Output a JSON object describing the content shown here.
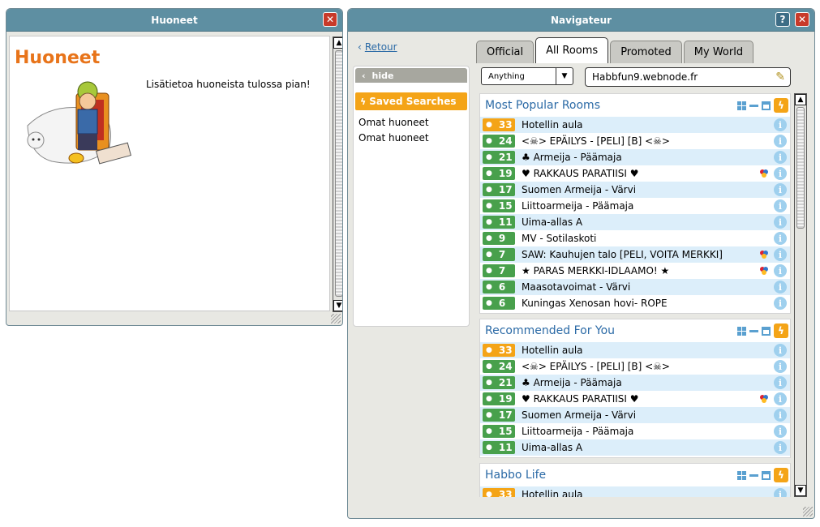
{
  "huoneet": {
    "title": "Huoneet",
    "heading": "Huoneet",
    "text": "Lisätietoa huoneista tulossa pian!"
  },
  "navigator": {
    "title": "Navigateur",
    "back": "Retour",
    "tabs": [
      "Official",
      "All Rooms",
      "Promoted",
      "My World"
    ],
    "active_tab": "All Rooms",
    "sidebar": {
      "hide": "hide",
      "saved_searches": "Saved Searches",
      "links": [
        "Omat huoneet",
        "Omat huoneet"
      ]
    },
    "filter": "Anything",
    "search_value": "Habbfun9.webnode.fr",
    "sections": [
      {
        "title": "Most Popular Rooms",
        "rooms": [
          {
            "count": "33",
            "name": "Hotellin aula",
            "color": "orange",
            "group": false
          },
          {
            "count": "24",
            "name": "<☠> EPÄILYS - [PELI] [B] <☠>",
            "color": "green",
            "group": false
          },
          {
            "count": "21",
            "name": "♣ Armeija - Päämaja",
            "color": "green",
            "group": false
          },
          {
            "count": "19",
            "name": "♥  RAKKAUS PARATIISI ♥",
            "color": "green",
            "group": true
          },
          {
            "count": "17",
            "name": "Suomen Armeija - Värvi",
            "color": "green",
            "group": false
          },
          {
            "count": "15",
            "name": "Liittoarmeija - Päämaja",
            "color": "green",
            "group": false
          },
          {
            "count": "11",
            "name": "Uima-allas A",
            "color": "green",
            "group": false
          },
          {
            "count": "9",
            "name": "MV - Sotilaskoti",
            "color": "green",
            "group": false
          },
          {
            "count": "7",
            "name": "SAW: Kauhujen talo [PELI, VOITA MERKKI]",
            "color": "green",
            "group": true
          },
          {
            "count": "7",
            "name": "★ PARAS MERKKI-IDLAAMO! ★",
            "color": "green",
            "group": true
          },
          {
            "count": "6",
            "name": "Maasotavoimat - Värvi",
            "color": "green",
            "group": false
          },
          {
            "count": "6",
            "name": "Kuningas Xenosan hovi- ROPE",
            "color": "green",
            "group": false
          }
        ]
      },
      {
        "title": "Recommended For You",
        "rooms": [
          {
            "count": "33",
            "name": "Hotellin aula",
            "color": "orange",
            "group": false
          },
          {
            "count": "24",
            "name": "<☠> EPÄILYS - [PELI] [B] <☠>",
            "color": "green",
            "group": false
          },
          {
            "count": "21",
            "name": "♣ Armeija - Päämaja",
            "color": "green",
            "group": false
          },
          {
            "count": "19",
            "name": "♥  RAKKAUS PARATIISI ♥",
            "color": "green",
            "group": true
          },
          {
            "count": "17",
            "name": "Suomen Armeija - Värvi",
            "color": "green",
            "group": false
          },
          {
            "count": "15",
            "name": "Liittoarmeija - Päämaja",
            "color": "green",
            "group": false
          },
          {
            "count": "11",
            "name": "Uima-allas A",
            "color": "green",
            "group": false
          }
        ]
      },
      {
        "title": "Habbo Life",
        "rooms": [
          {
            "count": "33",
            "name": "Hotellin aula",
            "color": "orange",
            "group": false
          }
        ]
      }
    ]
  }
}
